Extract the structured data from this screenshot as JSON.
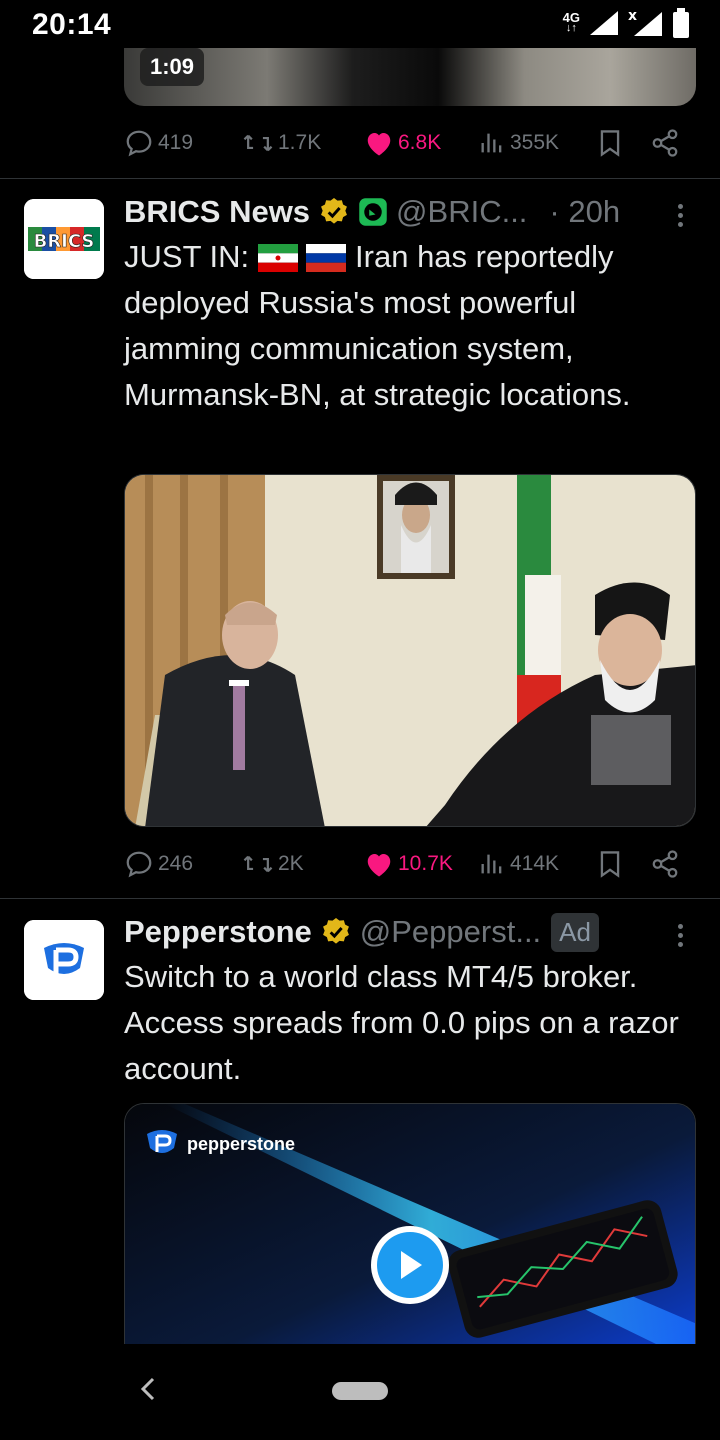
{
  "status_bar": {
    "time": "20:14",
    "network": "4G"
  },
  "previous_tweet": {
    "video_duration": "1:09",
    "replies": "419",
    "reposts": "1.7K",
    "likes": "6.8K",
    "views": "355K"
  },
  "tweet1": {
    "avatar_text": "BRICS",
    "display_name": "BRICS News",
    "handle": "@BRIC...",
    "time": "· 20h",
    "text_prefix": "JUST IN:",
    "text_body": " Iran has reportedly deployed Russia's most powerful jamming communication system, Murmansk-BN, at strategic locations.",
    "replies": "246",
    "reposts": "2K",
    "likes": "10.7K",
    "views": "414K"
  },
  "tweet2": {
    "display_name": "Pepperstone",
    "handle": "@Pepperst...",
    "ad_label": "Ad",
    "text": "Switch to a world class MT4/5 broker. Access spreads from 0.0 pips on a razor account.",
    "media_brand": "pepperstone"
  },
  "colors": {
    "background": "#000000",
    "text_primary": "#e7e9ea",
    "text_secondary": "#71767b",
    "like_pink": "#f91880",
    "verified_gold": "#e2b719",
    "divider": "#2f3336",
    "brand_blue": "#1d9bf0"
  }
}
